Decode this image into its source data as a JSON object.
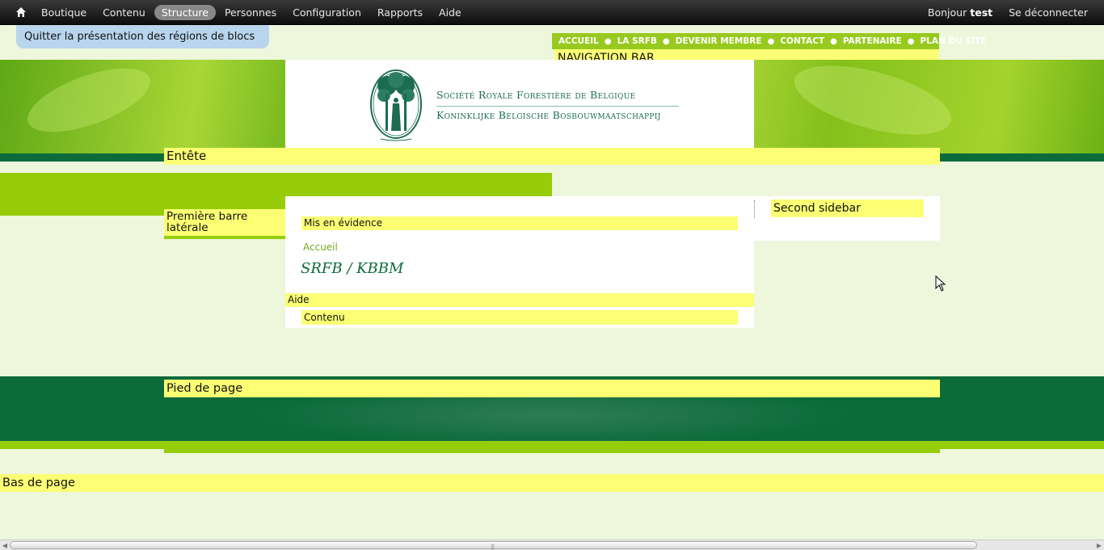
{
  "toolbar": {
    "menu": [
      "Boutique",
      "Contenu",
      "Structure",
      "Personnes",
      "Configuration",
      "Rapports",
      "Aide"
    ],
    "active": "Structure",
    "greeting": "Bonjour",
    "username": "test",
    "logout": "Se déconnecter"
  },
  "exit_demo": "Quitter la présentation des régions de blocs",
  "top_nav": [
    "ACCUEIL",
    "LA SRFB",
    "DEVENIR MEMBRE",
    "CONTACT",
    "PARTENAIRE",
    "PLAN DU SITE"
  ],
  "regions": {
    "navigation": "NAVIGATION BAR",
    "header": "Entête",
    "sidebar_first": "Première barre latérale",
    "highlighted": "Mis en évidence",
    "help": "Aide",
    "content": "Contenu",
    "sidebar_second": "Second sidebar",
    "footer": "Pied de page",
    "bottom": "Bas de page"
  },
  "logo": {
    "line1": "Société Royale Forestière de Belgique",
    "line2": "Koninklijke Belgische Bosbouwmaatschappij"
  },
  "breadcrumb": "Accueil",
  "page_title": "SRFB / KBBM",
  "colors": {
    "region_yellow": "#fcff74",
    "brand_green": "#0b6b3a",
    "leaf_green": "#96cd08",
    "toolbar_dark": "#1a1a1a"
  }
}
